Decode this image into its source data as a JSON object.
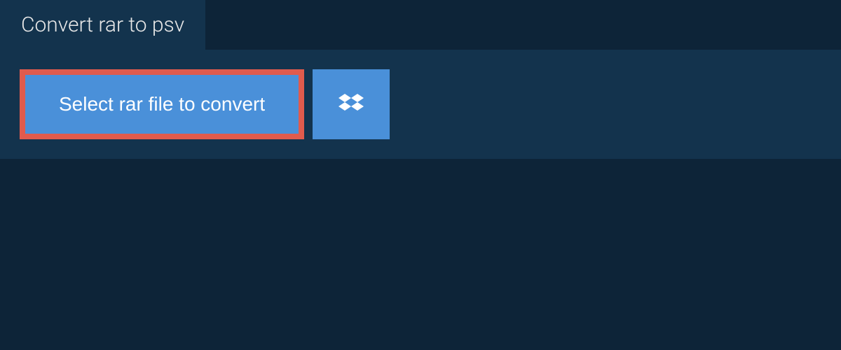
{
  "tab": {
    "title": "Convert rar to psv"
  },
  "actions": {
    "select_file_label": "Select rar file to convert"
  }
}
